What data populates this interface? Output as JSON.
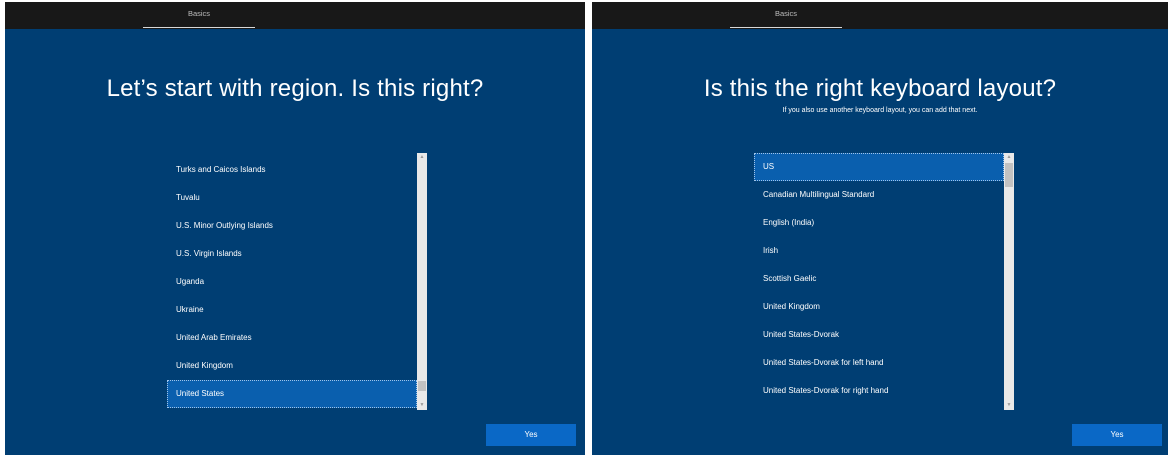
{
  "left_panel": {
    "tab_label": "Basics",
    "title": "Let’s start with region. Is this right?",
    "list_items": [
      "Turks and Caicos Islands",
      "Tuvalu",
      "U.S. Minor Outlying Islands",
      "U.S. Virgin Islands",
      "Uganda",
      "Ukraine",
      "United Arab Emirates",
      "United Kingdom",
      "United States"
    ],
    "selected_item": "United States",
    "yes_label": "Yes"
  },
  "right_panel": {
    "tab_label": "Basics",
    "title": "Is this the right keyboard layout?",
    "subtitle": "If you also use another keyboard layout, you can add that next.",
    "list_items": [
      "US",
      "Canadian Multilingual Standard",
      "English (India)",
      "Irish",
      "Scottish Gaelic",
      "United Kingdom",
      "United States-Dvorak",
      "United States-Dvorak for left hand",
      "United States-Dvorak for right hand"
    ],
    "selected_item": "US",
    "yes_label": "Yes"
  },
  "colors": {
    "background": "#003e73",
    "selected": "#0a5fae",
    "button": "#0a68c6",
    "topbar": "#181818"
  },
  "icons": {
    "scroll_up": "scroll-up-arrow-icon",
    "scroll_down": "scroll-down-arrow-icon"
  }
}
